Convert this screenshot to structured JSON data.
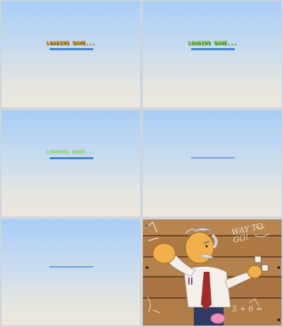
{
  "loading": {
    "label": "LOADING GAME..."
  },
  "frames": [
    {
      "label_color": "#f5a623",
      "progress": 1.0
    },
    {
      "label_color": "#8ee63c",
      "progress": 1.0
    },
    {
      "label_color": "#9fe07a",
      "progress": 1.0
    },
    {
      "progress": 1.0
    },
    {
      "progress": 1.0
    }
  ],
  "game": {
    "speech": "WAY TO GO!",
    "math": "5 + 6 =",
    "accent_color": "#b07a45"
  }
}
